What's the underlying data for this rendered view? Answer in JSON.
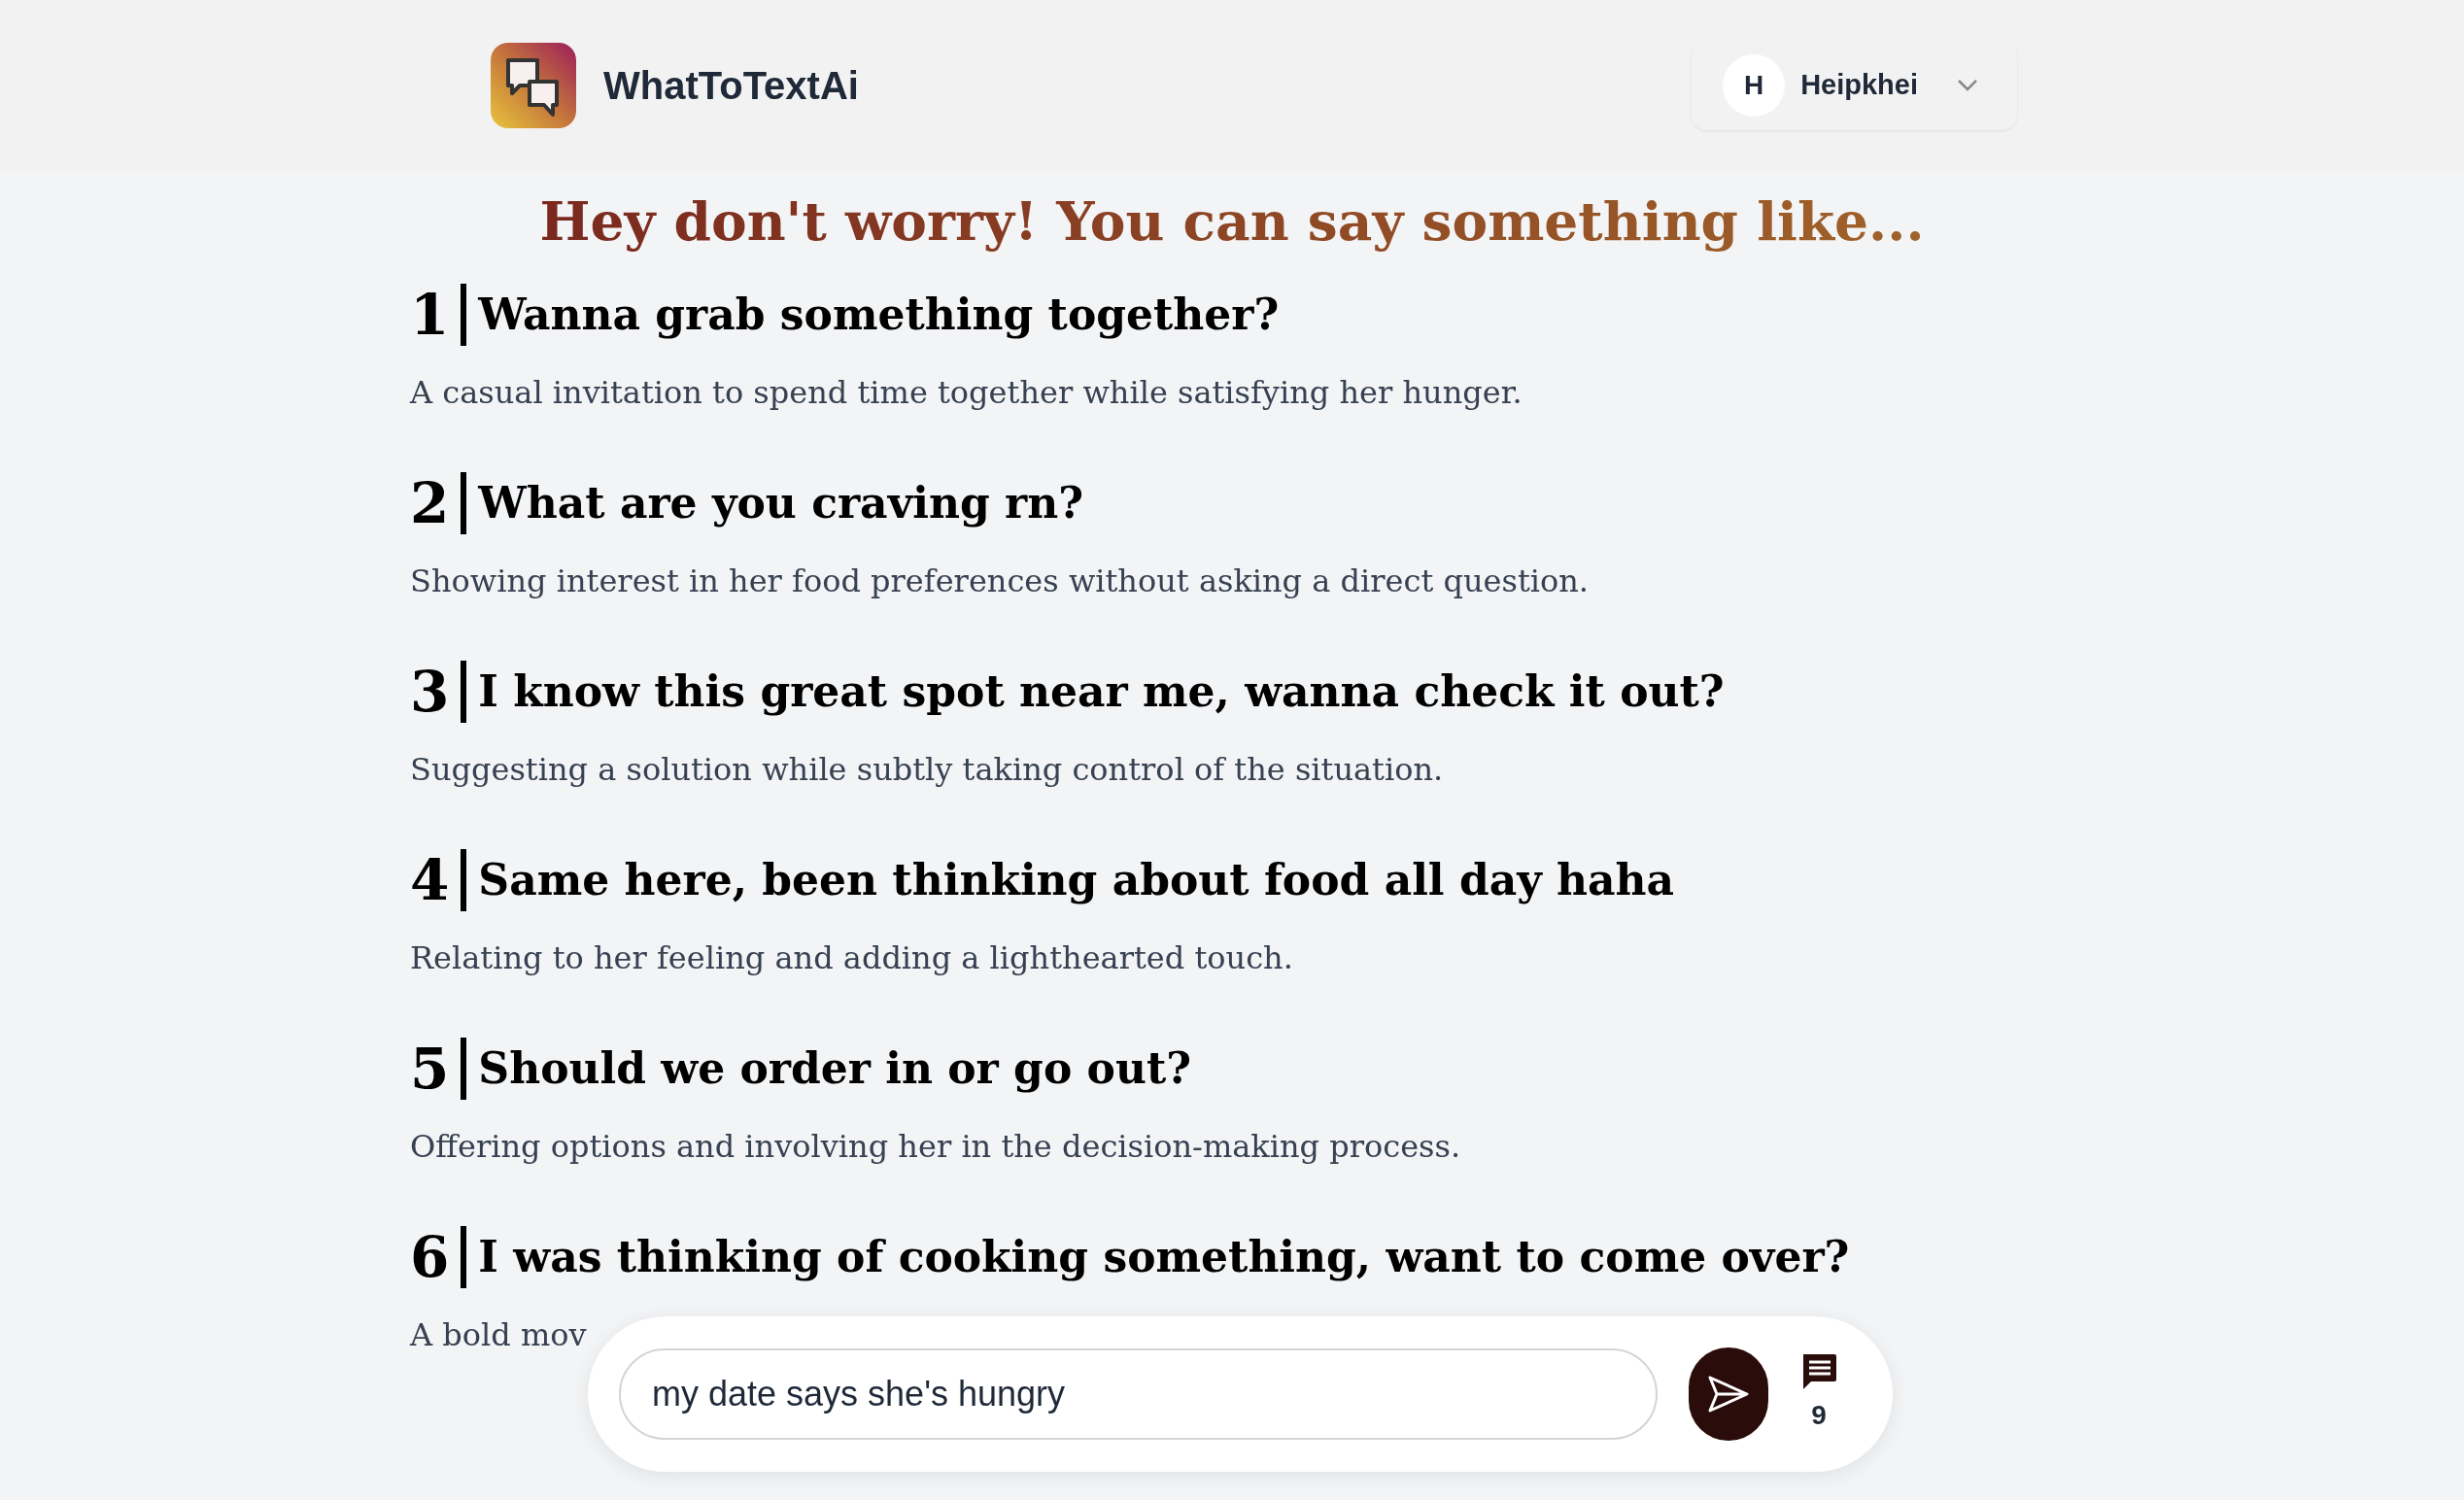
{
  "header": {
    "brand": "WhatToTextAi",
    "user": {
      "initial": "H",
      "name": "Heipkhei"
    }
  },
  "heading": "Hey don't worry! You can say something like...",
  "suggestions": [
    {
      "number": "1",
      "text": "Wanna grab something together?",
      "description": "A casual invitation to spend time together while satisfying her hunger."
    },
    {
      "number": "2",
      "text": "What are you craving rn?",
      "description": "Showing interest in her food preferences without asking a direct question."
    },
    {
      "number": "3",
      "text": "I know this great spot near me, wanna check it out?",
      "description": "Suggesting a solution while subtly taking control of the situation."
    },
    {
      "number": "4",
      "text": "Same here, been thinking about food all day haha",
      "description": "Relating to her feeling and adding a lighthearted touch."
    },
    {
      "number": "5",
      "text": "Should we order in or go out?",
      "description": "Offering options and involving her in the decision-making process."
    },
    {
      "number": "6",
      "text": "I was thinking of cooking something, want to come over?",
      "description": "A bold mov"
    }
  ],
  "composer": {
    "value": "my date says she's hungry",
    "message_count": "9"
  }
}
